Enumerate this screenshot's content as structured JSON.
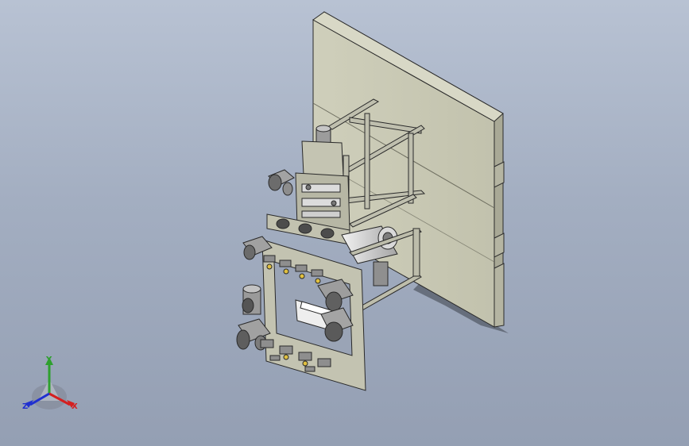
{
  "viewport": {
    "background_top": "#b8c2d3",
    "background_bottom": "#949fb3"
  },
  "model": {
    "panel_color": "#c9c9b4",
    "frame_color": "#bcbcaa",
    "edge_color": "#2a2a2a",
    "motor_color": "#9a9a9a"
  },
  "triad": {
    "x_label": "X",
    "y_label": "Y",
    "z_label": "Z",
    "x_color": "#d42020",
    "y_color": "#2ea02e",
    "z_color": "#2030d0"
  }
}
